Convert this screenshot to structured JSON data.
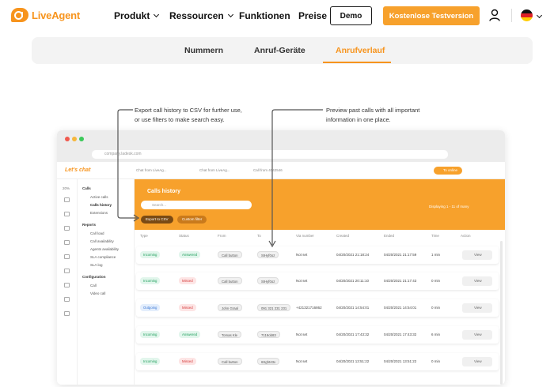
{
  "nav": {
    "logo": "LiveAgent",
    "items": [
      "Produkt",
      "Ressourcen",
      "Funktionen",
      "Preise"
    ],
    "demo": "Demo",
    "trial": "Kostenlose Testversion"
  },
  "tabs": [
    "Nummern",
    "Anruf-Geräte",
    "Anrufverlauf"
  ],
  "callouts": {
    "left": [
      "Export call history to CSV for further use,",
      "or use filters to make search easy."
    ],
    "right": [
      "Preview past calls with all important",
      "information in one place."
    ]
  },
  "app": {
    "url": "company.ladesk.com",
    "logo": "Let's chat",
    "chat_tabs": [
      "Chat from LiveAg...",
      "Chat from LiveAg...",
      "Call from 4042546"
    ],
    "online": "To online",
    "rail_pct": "20%",
    "sidebar": {
      "calls_head": "Calls",
      "calls": [
        "Active calls",
        "Calls history",
        "Extensions"
      ],
      "reports_head": "Reports",
      "reports": [
        "Call load",
        "Call availability",
        "Agents availability",
        "SLA compliance",
        "SLA log"
      ],
      "config_head": "Configuration",
      "config": [
        "Call",
        "Video call"
      ]
    },
    "hero": {
      "title": "Calls history",
      "search_placeholder": "Search...",
      "export": "Export to CSV",
      "filter": "Custom filter",
      "pager": "Displaying 1 - 11 of many"
    },
    "columns": [
      "Type",
      "Status",
      "From",
      "To",
      "Via number",
      "Created",
      "Ended",
      "Time",
      "Action"
    ],
    "rows": [
      {
        "type": "Incoming",
        "status": "Answered",
        "from": "Call button",
        "to": "SIHyf0oz",
        "via": "Not set",
        "created": "04/20/2021 21:18:24",
        "ended": "04/20/2021 21:17:59",
        "time": "1 min",
        "action": "View"
      },
      {
        "type": "Incoming",
        "status": "Missed",
        "from": "Call button",
        "to": "SIHyf0oz",
        "via": "Not set",
        "created": "04/20/2021 20:11:10",
        "ended": "04/20/2021 21:17:43",
        "time": "0 min",
        "action": "View"
      },
      {
        "type": "Outgoing",
        "status": "Missed",
        "from": "John Graal",
        "to": "091 321 231 231",
        "via": "+421321716862",
        "created": "04/20/2021 14:54:01",
        "ended": "04/20/2021 14:54:01",
        "time": "0 min",
        "action": "View"
      },
      {
        "type": "Incoming",
        "status": "Answered",
        "from": "Tomas Kle",
        "to": "7119ob83",
        "via": "Not set",
        "created": "04/20/2021 17:43:32",
        "ended": "04/20/2021 17:43:32",
        "time": "6 min",
        "action": "View"
      },
      {
        "type": "Incoming",
        "status": "Missed",
        "from": "Call button",
        "to": "6Sght43x",
        "via": "Not set",
        "created": "04/20/2021 13:51:22",
        "ended": "04/20/2021 13:51:22",
        "time": "0 min",
        "action": "View"
      }
    ]
  },
  "colors": {
    "accent": "#f7941d",
    "hero": "#f7a12c",
    "green": "#1f9e5c",
    "red": "#d63a3a",
    "blue": "#3a78d6"
  }
}
